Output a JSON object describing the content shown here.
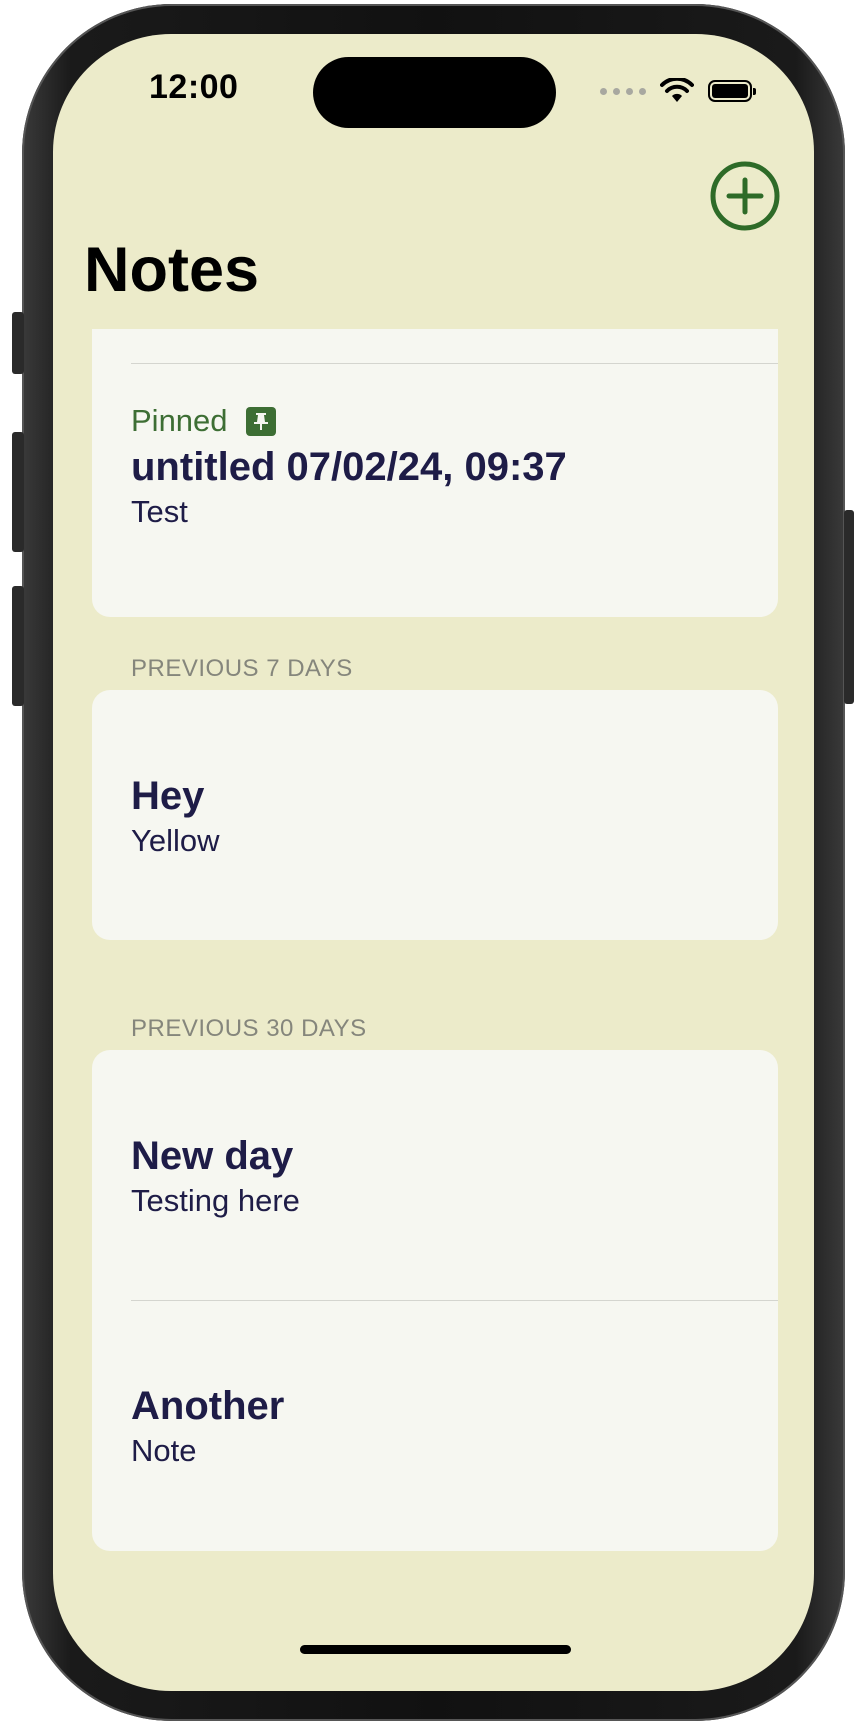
{
  "status_bar": {
    "time": "12:00",
    "wifi_icon": "wifi-icon",
    "battery_icon": "battery-icon"
  },
  "header": {
    "title": "Notes",
    "add_icon": "plus-circle-icon",
    "accent_color": "#2e6b28"
  },
  "pinned": {
    "label": "Pinned",
    "pin_icon": "pin-icon",
    "notes": [
      {
        "title": "untitled 07/02/24, 09:37",
        "preview": "Test"
      }
    ]
  },
  "sections": [
    {
      "header": "PREVIOUS 7 DAYS",
      "notes": [
        {
          "title": "Hey",
          "preview": "Yellow"
        }
      ]
    },
    {
      "header": "PREVIOUS 30 DAYS",
      "notes": [
        {
          "title": "New day",
          "preview": "Testing here"
        },
        {
          "title": "Another",
          "preview": "Note"
        }
      ]
    }
  ],
  "colors": {
    "background": "#ecebca",
    "card": "#f6f7f1",
    "title_text": "#1e1c47",
    "pinned_green": "#3d6e34",
    "section_header": "#85867c"
  }
}
